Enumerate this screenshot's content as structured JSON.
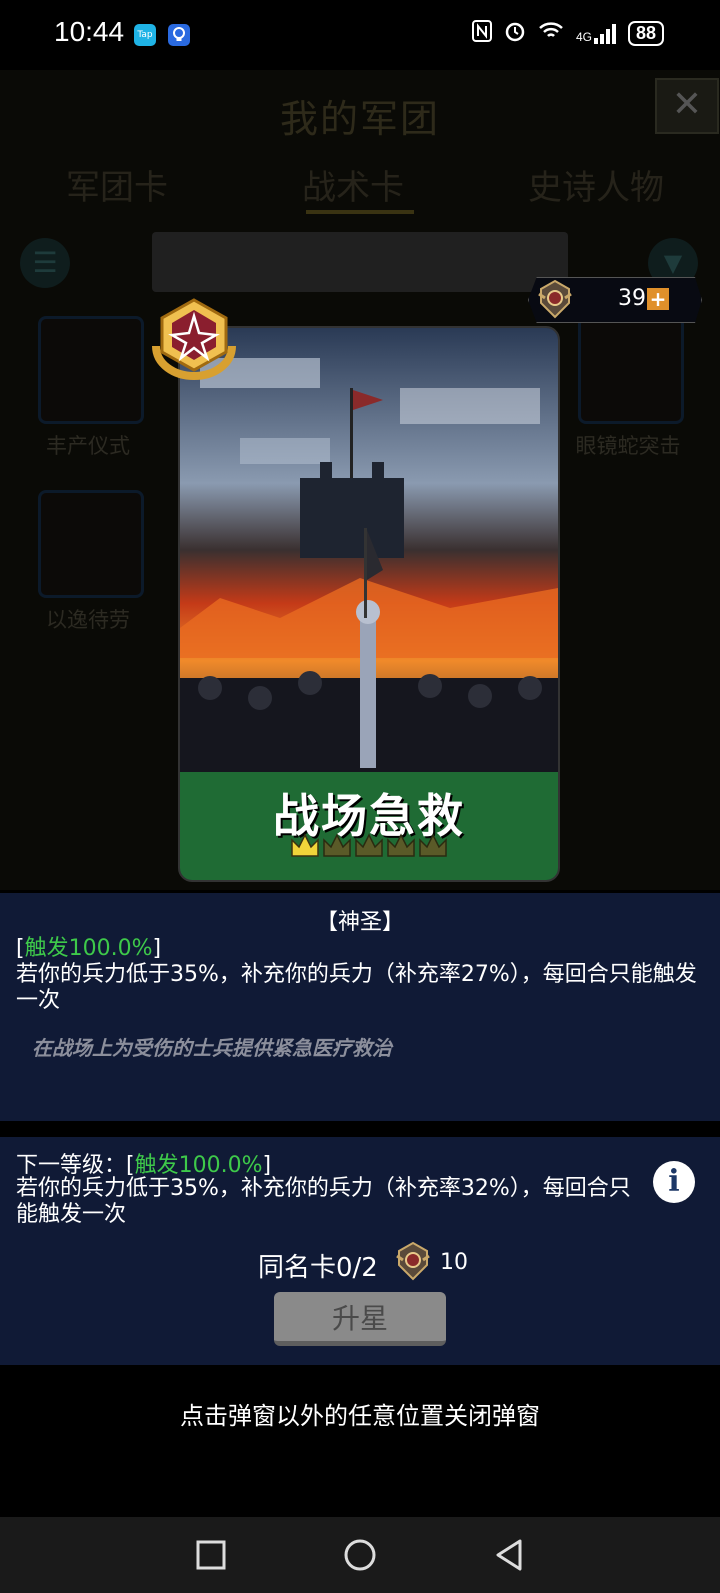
{
  "status_bar": {
    "time": "10:44",
    "app_icon_1": "TapTap",
    "app_icon_2": "bulb-icon",
    "battery": "88",
    "network": "4G"
  },
  "background": {
    "title": "我的军团",
    "tabs": [
      "军团卡",
      "战术卡",
      "史诗人物"
    ],
    "cards": [
      "丰产仪式",
      "眼镜蛇突击",
      "以逸待劳"
    ]
  },
  "currency": {
    "value": "39",
    "plus": "+"
  },
  "card": {
    "name": "战场急救",
    "stars_filled": 1,
    "stars_total": 5
  },
  "description": {
    "tag": "【神圣】",
    "trigger_prefix": "[",
    "trigger": "触发100.0%",
    "trigger_suffix": "]",
    "effect": "若你的兵力低于35%，补充你的兵力（补充率27%），每回合只能触发一次",
    "flavor": "在战场上为受伤的士兵提供紧急医疗救治"
  },
  "next_level": {
    "prefix": "下一等级：[",
    "trigger": "触发100.0%",
    "suffix": "]",
    "effect": "若你的兵力低于35%，补充你的兵力（补充率32%），每回合只能触发一次"
  },
  "upgrade": {
    "duplicate_label": "同名卡0/2",
    "cost": "10",
    "button": "升星"
  },
  "close_hint": "点击弹窗以外的任意位置关闭弹窗",
  "colors": {
    "panel": "#101a36",
    "trigger_green": "#3ec94a",
    "card_name_bg": "#1f6b34",
    "button_disabled": "#8a8a8a"
  }
}
